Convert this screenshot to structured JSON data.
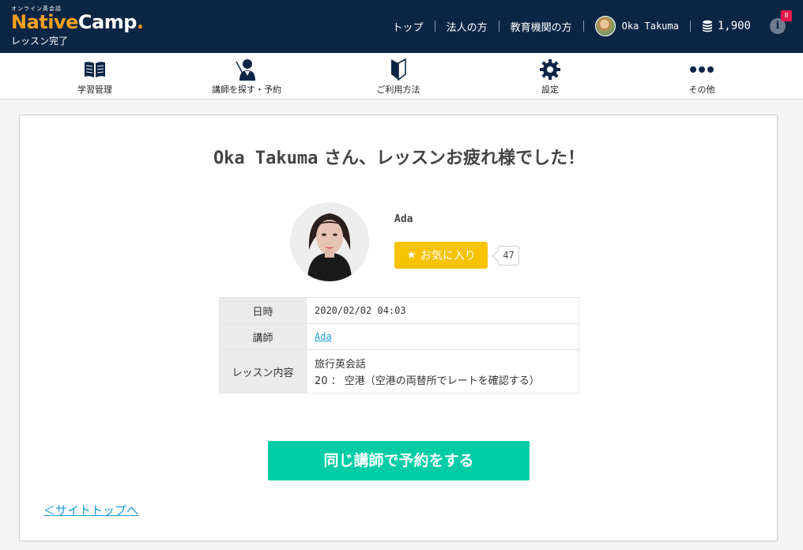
{
  "header": {
    "logo_small": "オンライン英会話",
    "logo_native": "Native",
    "logo_camp": "Camp",
    "logo_dot": ".",
    "logo_sub": "レッスン完了",
    "nav": [
      {
        "label": "トップ"
      },
      {
        "label": "法人の方"
      },
      {
        "label": "教育機関の方"
      }
    ],
    "user_name": "Oka Takuma",
    "coins": "1,900",
    "notify_symbol": "i",
    "notify_count": "8"
  },
  "subnav": [
    {
      "label": "学習管理",
      "icon": "book-icon"
    },
    {
      "label": "講師を探す・予約",
      "icon": "teacher-icon"
    },
    {
      "label": "ご利用方法",
      "icon": "beginner-mark-icon"
    },
    {
      "label": "設定",
      "icon": "gear-icon"
    },
    {
      "label": "その他",
      "icon": "more-dots-icon"
    }
  ],
  "main": {
    "title_name": "Oka Takuma",
    "title_rest": " さん、レッスンお疲れ様でした！",
    "teacher_name": "Ada",
    "favorite_label": "お気に入り",
    "favorite_count": "47",
    "table": {
      "datetime_label": "日時",
      "datetime_value": "2020/02/02 04:03",
      "teacher_label": "講師",
      "teacher_value": "Ada",
      "lesson_label": "レッスン内容",
      "lesson_course": "旅行英会話",
      "lesson_detail": "20 ： 空港（空港の両替所でレートを確認する）"
    },
    "book_button": "同じ講師で予約をする",
    "back_link": "＜サイトトップへ"
  },
  "colors": {
    "header_bg": "#0b2545",
    "accent_orange": "#f7a21b",
    "favorite": "#f7c200",
    "primary_button": "#00cda6",
    "link": "#1a9bd7"
  }
}
